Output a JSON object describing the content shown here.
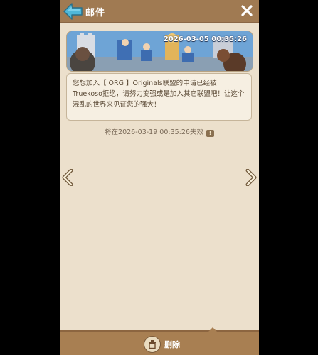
{
  "header": {
    "title": "邮件"
  },
  "banner": {
    "date": "2026-03-05 00:35:26"
  },
  "message": {
    "body": "您想加入【 ORG 】Originals联盟的申请已经被Truekoso拒绝，请努力变强或是加入其它联盟吧！让这个混乱的世界来见证您的强大！"
  },
  "expiry": {
    "text": "将在2026-03-19 00:35:26失效",
    "icon": "!"
  },
  "footer": {
    "delete_label": "删除"
  },
  "icons": {
    "back": "back-arrow-icon",
    "close": "close-icon",
    "prev": "chevron-left-icon",
    "next": "chevron-right-icon",
    "delete": "trash-icon"
  },
  "colors": {
    "header": "#a07a52",
    "panel": "#ece0cc",
    "footer": "#a87f52",
    "accent_arrow": "#4fb8d9"
  }
}
